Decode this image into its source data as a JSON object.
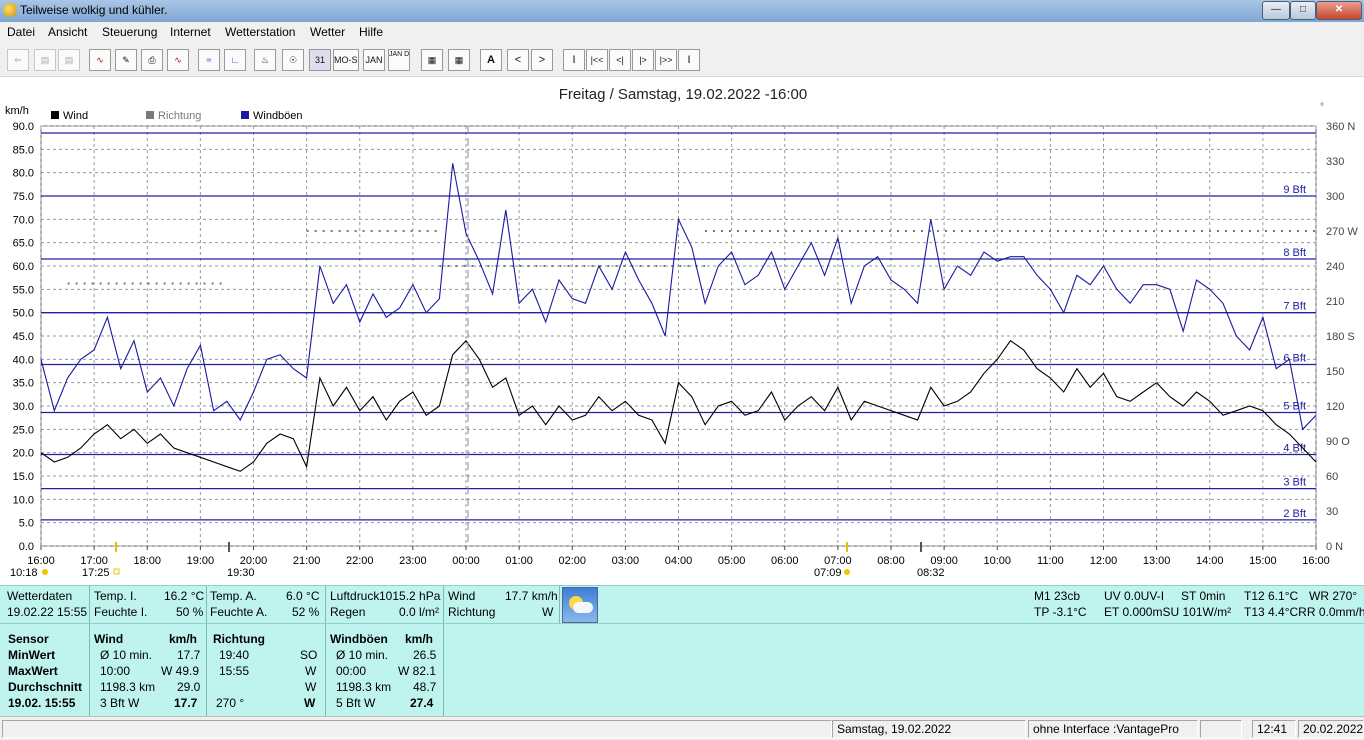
{
  "window": {
    "title": "Teilweise wolkig und kühler."
  },
  "menu": [
    "Datei",
    "Ansicht",
    "Steuerung",
    "Internet",
    "Wetterstation",
    "Wetter",
    "Hilfe"
  ],
  "toolbar": {
    "buttons": [
      "31",
      "MO-SU",
      "JAN",
      "JAN DEC",
      "A",
      "<",
      ">",
      "I",
      "|<<",
      "<|",
      "|>",
      "|>>",
      "I"
    ]
  },
  "chart_data": {
    "type": "line",
    "title": "Freitag / Samstag, 19.02.2022  -16:00",
    "ylabel": "km/h",
    "ylim": [
      0,
      90
    ],
    "y_ticks": [
      "0.0",
      "5.0",
      "10.0",
      "15.0",
      "20.0",
      "25.0",
      "30.0",
      "35.0",
      "40.0",
      "45.0",
      "50.0",
      "55.0",
      "60.0",
      "65.0",
      "70.0",
      "75.0",
      "80.0",
      "85.0",
      "90.0"
    ],
    "y2_ticks": [
      "0 N",
      "30",
      "60",
      "90 O",
      "120",
      "150",
      "180 S",
      "210",
      "240",
      "270 W",
      "300",
      "330",
      "360 N"
    ],
    "y2_degree_mark": "°",
    "x_ticks": [
      "16:00",
      "17:00",
      "18:00",
      "19:00",
      "20:00",
      "21:00",
      "22:00",
      "23:00",
      "00:00",
      "01:00",
      "02:00",
      "03:00",
      "04:00",
      "05:00",
      "06:00",
      "07:00",
      "08:00",
      "09:00",
      "10:00",
      "11:00",
      "12:00",
      "13:00",
      "14:00",
      "15:00",
      "16:00"
    ],
    "legend": [
      "Wind",
      "Richtung",
      "Windböen"
    ],
    "colors": {
      "wind": "#000000",
      "direction": "#7a7a7a",
      "gusts": "#1a1aa0",
      "beaufort_lines": "#2020a0"
    },
    "beaufort": [
      {
        "label": "2 Bft",
        "kmh": 5.6
      },
      {
        "label": "3 Bft",
        "kmh": 12.3
      },
      {
        "label": "4 Bft",
        "kmh": 19.6
      },
      {
        "label": "5 Bft",
        "kmh": 28.6
      },
      {
        "label": "6 Bft",
        "kmh": 38.9
      },
      {
        "label": "7 Bft",
        "kmh": 50.0
      },
      {
        "label": "8 Bft",
        "kmh": 61.5
      },
      {
        "label": "9 Bft",
        "kmh": 75.0
      },
      {
        "label": "",
        "kmh": 88.5
      }
    ],
    "sun_events": [
      "10:18",
      "17:25",
      "19:30",
      "07:09",
      "08:32"
    ],
    "series": [
      {
        "name": "Windböen",
        "times": [
          0,
          0.25,
          0.5,
          0.75,
          1,
          1.25,
          1.5,
          1.75,
          2,
          2.25,
          2.5,
          2.75,
          3,
          3.25,
          3.5,
          3.75,
          4,
          4.25,
          4.5,
          4.75,
          5,
          5.25,
          5.5,
          5.75,
          6,
          6.25,
          6.5,
          6.75,
          7,
          7.25,
          7.5,
          7.75,
          8,
          8.25,
          8.5,
          8.75,
          9,
          9.25,
          9.5,
          9.75,
          10,
          10.25,
          10.5,
          10.75,
          11,
          11.25,
          11.5,
          11.75,
          12,
          12.25,
          12.5,
          12.75,
          13,
          13.25,
          13.5,
          13.75,
          14,
          14.25,
          14.5,
          14.75,
          15,
          15.25,
          15.5,
          15.75,
          16,
          16.25,
          16.5,
          16.75,
          17,
          17.25,
          17.5,
          17.75,
          18,
          18.25,
          18.5,
          18.75,
          19,
          19.25,
          19.5,
          19.75,
          20,
          20.25,
          20.5,
          20.75,
          21,
          21.25,
          21.5,
          21.75,
          22,
          22.25,
          22.5,
          22.75,
          23,
          23.25,
          23.5,
          23.75,
          24
        ],
        "values": [
          40,
          29,
          36,
          40,
          42,
          49,
          38,
          44,
          33,
          36,
          30,
          38,
          43,
          29,
          31,
          27,
          33,
          40,
          41,
          38,
          36,
          60,
          52,
          56,
          48,
          54,
          49,
          51,
          56,
          50,
          53,
          82,
          67,
          61,
          54,
          72,
          52,
          55,
          48,
          57,
          53,
          52,
          60,
          55,
          63,
          57,
          52,
          45,
          70,
          64,
          52,
          60,
          63,
          56,
          58,
          63,
          55,
          60,
          65,
          58,
          66,
          52,
          60,
          62,
          57,
          55,
          52,
          70,
          55,
          60,
          58,
          63,
          61,
          62,
          62,
          58,
          55,
          50,
          58,
          56,
          60,
          55,
          52,
          56,
          56,
          55,
          46,
          57,
          55,
          52,
          45,
          42,
          49,
          38,
          40,
          25,
          28
        ]
      },
      {
        "name": "Wind",
        "times": [
          0,
          0.25,
          0.5,
          0.75,
          1,
          1.25,
          1.5,
          1.75,
          2,
          2.25,
          2.5,
          2.75,
          3,
          3.25,
          3.5,
          3.75,
          4,
          4.25,
          4.5,
          4.75,
          5,
          5.25,
          5.5,
          5.75,
          6,
          6.25,
          6.5,
          6.75,
          7,
          7.25,
          7.5,
          7.75,
          8,
          8.25,
          8.5,
          8.75,
          9,
          9.25,
          9.5,
          9.75,
          10,
          10.25,
          10.5,
          10.75,
          11,
          11.25,
          11.5,
          11.75,
          12,
          12.25,
          12.5,
          12.75,
          13,
          13.25,
          13.5,
          13.75,
          14,
          14.25,
          14.5,
          14.75,
          15,
          15.25,
          15.5,
          15.75,
          16,
          16.25,
          16.5,
          16.75,
          17,
          17.25,
          17.5,
          17.75,
          18,
          18.25,
          18.5,
          18.75,
          19,
          19.25,
          19.5,
          19.75,
          20,
          20.25,
          20.5,
          20.75,
          21,
          21.25,
          21.5,
          21.75,
          22,
          22.25,
          22.5,
          22.75,
          23,
          23.25,
          23.5,
          23.75,
          24
        ],
        "values": [
          20,
          18,
          19,
          21,
          24,
          26,
          23,
          25,
          22,
          24,
          21,
          20,
          19,
          18,
          17,
          16,
          18,
          22,
          24,
          23,
          17,
          36,
          30,
          34,
          29,
          32,
          27,
          31,
          33,
          28,
          30,
          41,
          44,
          40,
          34,
          36,
          28,
          30,
          26,
          30,
          27,
          28,
          32,
          29,
          31,
          28,
          27,
          22,
          35,
          32,
          26,
          30,
          31,
          28,
          29,
          33,
          27,
          30,
          32,
          29,
          34,
          27,
          31,
          30,
          29,
          28,
          27,
          34,
          30,
          31,
          33,
          37,
          40,
          44,
          42,
          38,
          36,
          33,
          38,
          34,
          37,
          32,
          31,
          33,
          35,
          32,
          30,
          33,
          31,
          28,
          29,
          30,
          29,
          26,
          24,
          21,
          18
        ]
      },
      {
        "name": "Richtung",
        "segments": [
          {
            "t_start": 0.5,
            "t_end": 3.5,
            "deg": 225
          },
          {
            "t_start": 5.0,
            "t_end": 7.5,
            "deg": 270
          },
          {
            "t_start": 7.5,
            "t_end": 12.5,
            "deg": 240
          },
          {
            "t_start": 12.5,
            "t_end": 24,
            "deg": 270
          }
        ]
      }
    ]
  },
  "panel1": {
    "wetterdaten_label": "Wetterdaten",
    "wetterdaten_time": "19.02.22 15:55",
    "temp_i_label": "Temp. I.",
    "temp_i_value": "16.2 °C",
    "feuchte_i_label": "Feuchte I.",
    "feuchte_i_value": "50 %",
    "temp_a_label": "Temp. A.",
    "temp_a_value": "6.0 °C",
    "feuchte_a_label": "Feuchte A.",
    "feuchte_a_value": "52 %",
    "luftdruck_label": "Luftdruck",
    "luftdruck_value": "1015.2 hPa",
    "regen_label": "Regen",
    "regen_value": "0.0 l/m²",
    "wind_label": "Wind",
    "wind_value": "17.7 km/h",
    "richtung_label": "Richtung",
    "richtung_value": "W",
    "m1": "M1 23cb",
    "uv": "UV 0.0UV-I",
    "st": "ST 0min",
    "t12": "T12 6.1°C",
    "wr": "WR 270°",
    "tp": "TP -3.1°C",
    "et": "ET 0.000mSU 101W/m²",
    "t13": "T13 4.4°CRR 0.0mm/h"
  },
  "panel2": {
    "sensor_header": "Sensor",
    "row_labels": [
      "MinWert",
      "MaxWert",
      "Durchschnitt",
      "19.02. 15:55"
    ],
    "wind_header": "Wind",
    "kmh": "km/h",
    "wind_cells": [
      [
        "Ø 10 min.",
        "17.7"
      ],
      [
        "10:00",
        "W 49.9"
      ],
      [
        "1198.3 km",
        "29.0"
      ],
      [
        "3 Bft W",
        "17.7"
      ]
    ],
    "richtung_header": "Richtung",
    "richtung_cells": [
      [
        "19:40",
        "SO"
      ],
      [
        "15:55",
        "W"
      ],
      [
        "",
        "W"
      ],
      [
        "270 °",
        "W"
      ]
    ],
    "gust_header": "Windböen",
    "gust_cells": [
      [
        "Ø 10 min.",
        "26.5"
      ],
      [
        "00:00",
        "W 82.1"
      ],
      [
        "1198.3 km",
        "48.7"
      ],
      [
        "5 Bft W",
        "27.4"
      ]
    ]
  },
  "statusbar": {
    "date": "Samstag, 19.02.2022",
    "interface": "ohne Interface :VantagePro",
    "time": "12:41",
    "today": "20.02.2022"
  }
}
